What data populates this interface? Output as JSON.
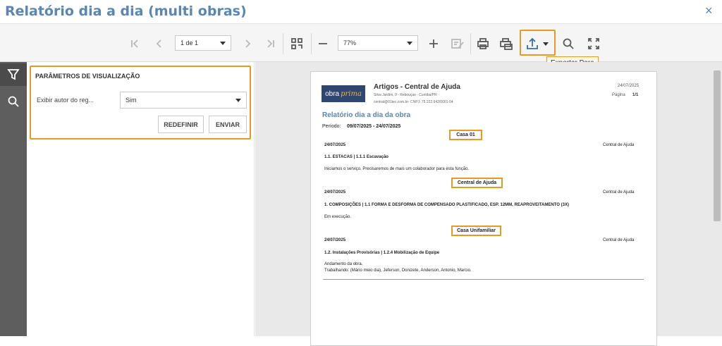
{
  "window": {
    "title": "Relatório dia a dia (multi obras)",
    "close_glyph": "×"
  },
  "toolbar": {
    "page_select": "1 de 1",
    "zoom_select": "77%",
    "export_tooltip": "Exportar Para",
    "icons": [
      "first-page-icon",
      "prev-page-icon",
      "next-page-icon",
      "last-page-icon",
      "multipage-icon",
      "zoom-out-icon",
      "zoom-in-icon",
      "edit-icon",
      "print-icon",
      "print-page-icon",
      "export-icon",
      "search-icon",
      "fullscreen-icon"
    ]
  },
  "sidebar": {
    "icons": [
      "filter-icon",
      "search-icon"
    ]
  },
  "params": {
    "title": "PARÂMETROS DE VISUALIZAÇÃO",
    "author_label": "Exibir autor do reg...",
    "author_value": "Sim",
    "reset_label": "REDEFINIR",
    "submit_label": "ENVIAR"
  },
  "report": {
    "logo_left": "obra",
    "logo_right": "prima",
    "company": "Artigos - Central de Ajuda",
    "address": "Silva Jardim, 0 - Rebouças - Curitiba/PR",
    "contact": "central@01tec.com.br- CNPJ: 75.222.642/0001-04",
    "date": "24/07/2025",
    "page_label": "Página",
    "page_value": "1/1",
    "heading": "Relatório dia a dia da obra",
    "period_label": "Período:",
    "period_value": "09/07/2025 -   24/07/2025",
    "sections": [
      {
        "tag": "Casa 01",
        "date": "24/07/2025",
        "author": "Central de Ajuda",
        "service": "1.1. ESTACAS | 1.1.1 Escavação",
        "note1": "Iniciamos o serviço. Precisaremos de mais um colaborador para esta função.",
        "note2": ""
      },
      {
        "tag": "Central de Ajuda",
        "date": "24/07/2025",
        "author": "Central de Ajuda",
        "service": "1. COMPOSIÇÕES | 1.1 FORMA E DESFORMA DE COMPENSADO PLASTIFICADO, ESP. 12MM, REAPROVEITAMENTO (3X)",
        "note1": "Em execução.",
        "note2": ""
      },
      {
        "tag": "Casa Unifamiliar",
        "date": "24/07/2025",
        "author": "Central de Ajuda",
        "service": "1.2. Instalações Provisórias | 1.2.4 Mobilização de Equipe",
        "note1": "Andamento da obra.",
        "note2": "Trabalhando: (Mário meio dia), Jeferson, Donizete, Anderson, Antonio, Marcio."
      }
    ]
  },
  "colors": {
    "accent": "#5a86b1",
    "highlight": "#e29b25",
    "sidebar": "#5e5e5e"
  }
}
